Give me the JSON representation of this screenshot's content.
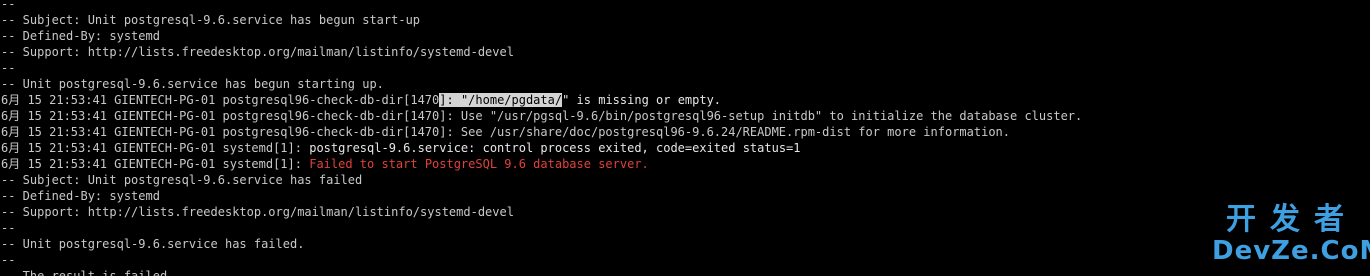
{
  "terminal": {
    "lines": [
      {
        "parts": [
          {
            "text": "--",
            "cls": ""
          }
        ]
      },
      {
        "parts": [
          {
            "text": "-- Subject: Unit postgresql-9.6.service has begun start-up",
            "cls": ""
          }
        ]
      },
      {
        "parts": [
          {
            "text": "-- Defined-By: systemd",
            "cls": ""
          }
        ]
      },
      {
        "parts": [
          {
            "text": "-- Support: http://lists.freedesktop.org/mailman/listinfo/systemd-devel",
            "cls": ""
          }
        ]
      },
      {
        "parts": [
          {
            "text": "--",
            "cls": ""
          }
        ]
      },
      {
        "parts": [
          {
            "text": "-- Unit postgresql-9.6.service has begun starting up.",
            "cls": ""
          }
        ]
      },
      {
        "parts": [
          {
            "text": "6月 15 21:53:41 GIENTECH-PG-01 postgresql96-check-db-dir[1470",
            "cls": ""
          },
          {
            "text": "]: \"/home/pgdata/",
            "cls": "sel"
          },
          {
            "text": "\" is missing or empty.",
            "cls": "bright"
          }
        ]
      },
      {
        "parts": [
          {
            "text": "6月 15 21:53:41 GIENTECH-PG-01 postgresql96-check-db-dir[1470]: Use \"/usr/pgsql-9.6/bin/postgresql96-setup initdb\" to initialize the database cluster.",
            "cls": ""
          }
        ]
      },
      {
        "parts": [
          {
            "text": "6月 15 21:53:41 GIENTECH-PG-01 postgresql96-check-db-dir[1470]: See /usr/share/doc/postgresql96-9.6.24/README.rpm-dist for more information.",
            "cls": ""
          }
        ]
      },
      {
        "parts": [
          {
            "text": "6月 15 21:53:41 GIENTECH-PG-01 systemd[1]: ",
            "cls": ""
          },
          {
            "text": "postgresql-9.6.service: control process exited, code=exited status=1",
            "cls": "bright"
          }
        ]
      },
      {
        "parts": [
          {
            "text": "6月 15 21:53:41 GIENTECH-PG-01 systemd[1]: ",
            "cls": ""
          },
          {
            "text": "Failed to start PostgreSQL 9.6 database server.",
            "cls": "err"
          }
        ]
      },
      {
        "parts": [
          {
            "text": "-- Subject: Unit postgresql-9.6.service has failed",
            "cls": ""
          }
        ]
      },
      {
        "parts": [
          {
            "text": "-- Defined-By: systemd",
            "cls": ""
          }
        ]
      },
      {
        "parts": [
          {
            "text": "-- Support: http://lists.freedesktop.org/mailman/listinfo/systemd-devel",
            "cls": ""
          }
        ]
      },
      {
        "parts": [
          {
            "text": "--",
            "cls": ""
          }
        ]
      },
      {
        "parts": [
          {
            "text": "-- Unit postgresql-9.6.service has failed.",
            "cls": ""
          }
        ]
      },
      {
        "parts": [
          {
            "text": "--",
            "cls": ""
          }
        ]
      },
      {
        "parts": [
          {
            "text": "-- The result is failed.",
            "cls": ""
          }
        ]
      }
    ]
  },
  "watermark": {
    "cn": "开发者",
    "en": "DevZe.CoM"
  },
  "colors": {
    "background": "#000000",
    "text": "#c8c8c8",
    "error": "#e0413b",
    "selection": "#d4d4d4",
    "watermark": "#3ea0e0"
  }
}
